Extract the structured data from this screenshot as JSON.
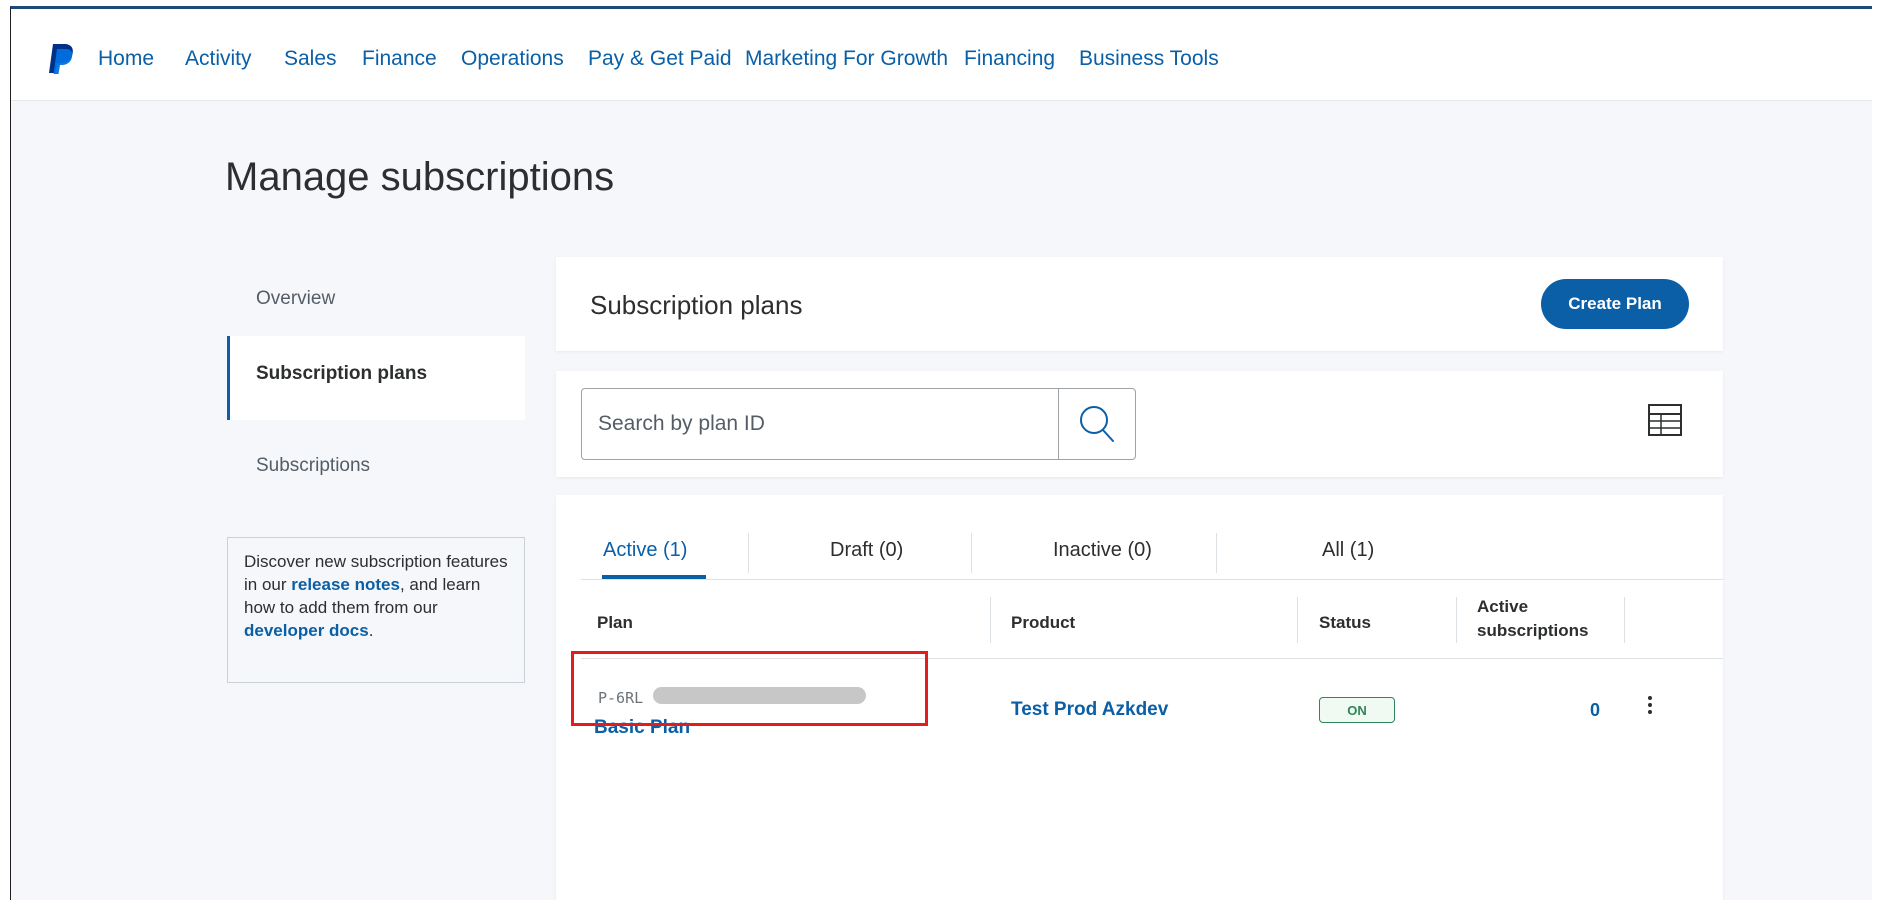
{
  "nav": {
    "items": [
      {
        "label": "Home"
      },
      {
        "label": "Activity"
      },
      {
        "label": "Sales"
      },
      {
        "label": "Finance"
      },
      {
        "label": "Operations"
      },
      {
        "label": "Pay & Get Paid"
      },
      {
        "label": "Marketing For Growth"
      },
      {
        "label": "Financing"
      },
      {
        "label": "Business Tools"
      }
    ]
  },
  "page": {
    "title": "Manage subscriptions"
  },
  "sidebar": {
    "items": [
      {
        "label": "Overview"
      },
      {
        "label": "Subscription plans",
        "active": true
      },
      {
        "label": "Subscriptions"
      }
    ],
    "info": {
      "text_1": "Discover new subscription features in our ",
      "link_1": "release notes",
      "text_2": ", and learn how to add them from our ",
      "link_2": "developer docs",
      "text_3": "."
    }
  },
  "plans_card": {
    "title": "Subscription plans",
    "create_label": "Create Plan"
  },
  "search": {
    "placeholder": "Search by plan ID"
  },
  "tabs": [
    {
      "label": "Active (1)",
      "active": true
    },
    {
      "label": "Draft (0)"
    },
    {
      "label": "Inactive (0)"
    },
    {
      "label": "All (1)"
    }
  ],
  "table": {
    "headers": {
      "plan": "Plan",
      "product": "Product",
      "status": "Status",
      "active_line1": "Active",
      "active_line2": "subscriptions"
    },
    "rows": [
      {
        "plan_id": "P-6RL",
        "plan_name": "Basic Plan",
        "product": "Test Prod Azkdev",
        "status": "ON",
        "active_subscriptions": "0"
      }
    ]
  },
  "icons": {
    "logo": "paypal-logo",
    "search": "search-icon",
    "table_view": "table-view-icon",
    "more": "more-vertical-icon"
  },
  "colors": {
    "brand_blue": "#0a5fa6",
    "status_green": "#2f855a",
    "highlight_red": "#e41c1c"
  }
}
